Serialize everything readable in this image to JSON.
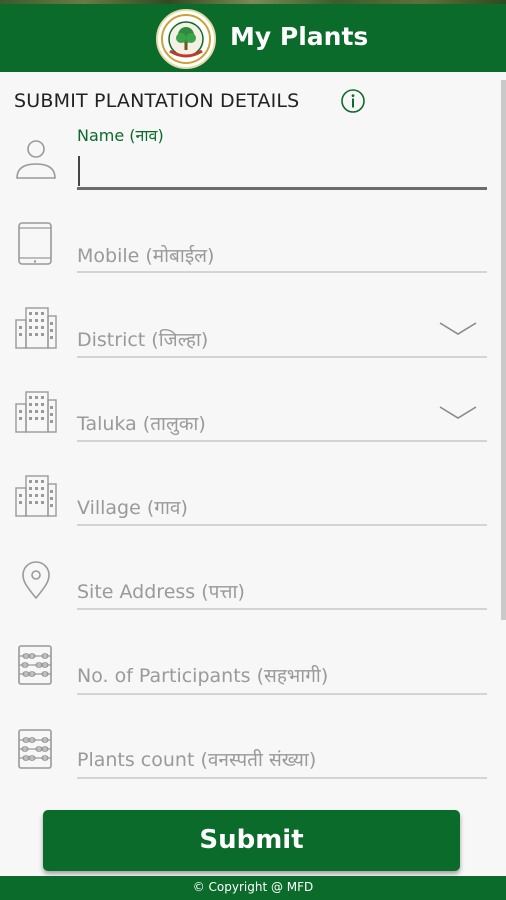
{
  "header": {
    "title": "My Plants",
    "accent_color": "#0b6b2b"
  },
  "form": {
    "section_title": "SUBMIT PLANTATION DETAILS",
    "fields": [
      {
        "label": "Name (नाव)",
        "icon": "person-icon"
      },
      {
        "placeholder": "Mobile (मोबाईल)",
        "icon": "phone-icon"
      },
      {
        "placeholder": "District (जिल्हा)",
        "icon": "building-icon",
        "dropdown": true
      },
      {
        "placeholder": "Taluka (तालुका)",
        "icon": "building-icon",
        "dropdown": true
      },
      {
        "placeholder": "Village (गाव)",
        "icon": "building-icon"
      },
      {
        "placeholder": "Site Address (पत्ता)",
        "icon": "location-pin-icon"
      },
      {
        "placeholder": "No. of Participants (सहभागी)",
        "icon": "abacus-icon"
      },
      {
        "placeholder": "Plants count (वनस्पती संख्या)",
        "icon": "abacus-icon"
      }
    ],
    "submit_label": "Submit"
  },
  "footer": {
    "copyright": "© Copyright @ MFD"
  }
}
